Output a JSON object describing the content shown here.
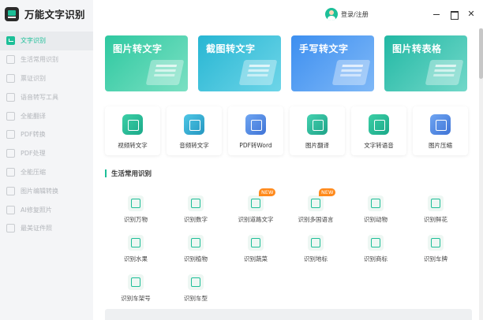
{
  "app": {
    "title": "万能文字识别"
  },
  "header": {
    "login_label": "登录/注册"
  },
  "sidebar": {
    "items": [
      {
        "label": "文字识别",
        "active": true
      },
      {
        "label": "生活常用识别"
      },
      {
        "label": "票证识别"
      },
      {
        "label": "语音转写工具"
      },
      {
        "label": "全能翻译"
      },
      {
        "label": "PDF转换"
      },
      {
        "label": "PDF处理"
      },
      {
        "label": "全能压缩"
      },
      {
        "label": "图片编辑转换"
      },
      {
        "label": "AI修复照片"
      },
      {
        "label": "最美证件照"
      }
    ]
  },
  "banners": [
    {
      "label": "图片转文字"
    },
    {
      "label": "截图转文字"
    },
    {
      "label": "手写转文字"
    },
    {
      "label": "图片转表格"
    }
  ],
  "tools": [
    {
      "label": "视频转文字"
    },
    {
      "label": "音频转文字"
    },
    {
      "label": "PDF转Word"
    },
    {
      "label": "图片翻译"
    },
    {
      "label": "文字转语音"
    },
    {
      "label": "图片压缩"
    }
  ],
  "section": {
    "title": "生活常用识别",
    "items": [
      {
        "label": "识别万物"
      },
      {
        "label": "识别数字"
      },
      {
        "label": "识别道路文字",
        "badge": "NEW"
      },
      {
        "label": "识别多国语言",
        "badge": "NEW"
      },
      {
        "label": "识别动物"
      },
      {
        "label": "识别鲜花"
      },
      {
        "label": "识别水果"
      },
      {
        "label": "识别植物"
      },
      {
        "label": "识别蔬菜"
      },
      {
        "label": "识别地标"
      },
      {
        "label": "识别商标"
      },
      {
        "label": "识别车牌"
      },
      {
        "label": "识别车架号"
      },
      {
        "label": "识别车型"
      }
    ]
  },
  "colors": {
    "accent": "#1dbf98",
    "badge": "#ff8a1c"
  }
}
